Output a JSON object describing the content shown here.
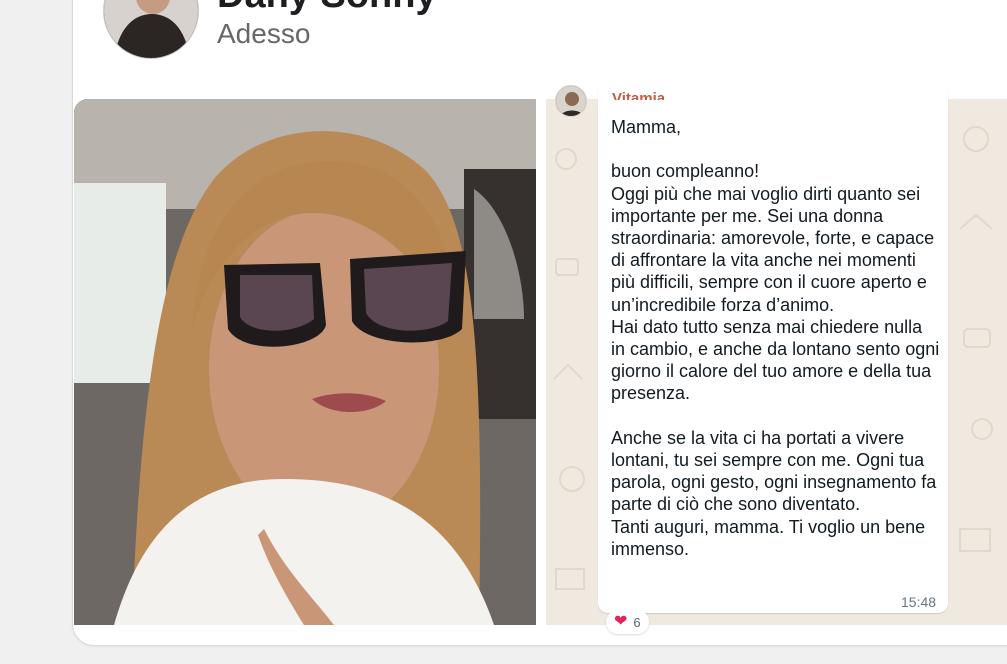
{
  "post": {
    "author": "Dany Sonny",
    "time": "Adesso"
  },
  "whatsapp": {
    "sender": "Vitamia",
    "message": "Mamma,\n\nbuon compleanno!\nOggi più che mai voglio dirti quanto sei importante per me. Sei una donna straordinaria: amorevole, forte, e capace di affrontare la vita anche nei momenti più difficili, sempre con il cuore aperto e un’incredibile forza d’animo.\nHai dato tutto senza mai chiedere nulla in cambio, e anche da lontano sento ogni giorno il calore del tuo amore e della tua presenza.\n\nAnche se la vita ci ha portati a vivere lontani, tu sei sempre con me. Ogni tua parola, ogni gesto, ogni insegnamento fa parte di ciò che sono diventato.\nTanti auguri, mamma. Ti voglio un bene immenso.",
    "time": "15:48",
    "reaction_count": "6",
    "reaction_icon": "heart-icon"
  },
  "colors": {
    "sender": "#c65b45",
    "chat_bg": "#efe9df",
    "heart": "#e0245e"
  }
}
